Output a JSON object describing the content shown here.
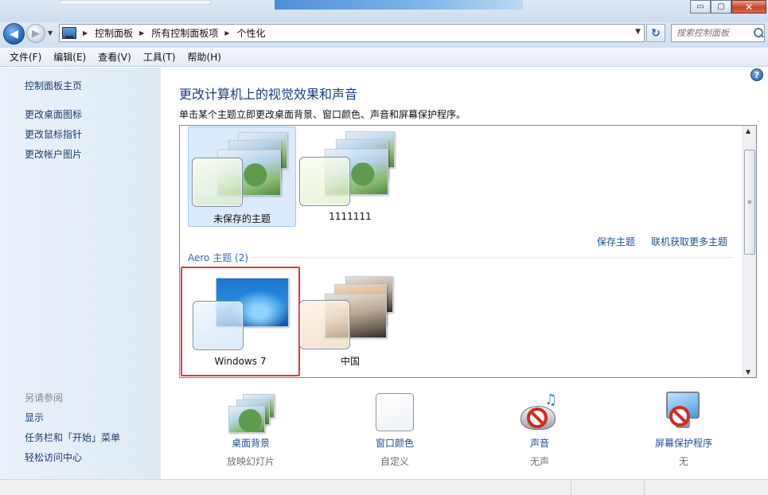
{
  "window": {
    "minimize_glyph": "▭",
    "restore_glyph": "▢",
    "close_glyph": "✕",
    "accent": "#1e4e9c"
  },
  "nav": {
    "back_glyph": "◀",
    "forward_glyph": "▶",
    "breadcrumb": [
      "控制面板",
      "所有控制面板项",
      "个性化"
    ],
    "refresh_glyph": "↻",
    "search_placeholder": "搜索控制面板"
  },
  "menu": {
    "items": [
      "文件(F)",
      "编辑(E)",
      "查看(V)",
      "工具(T)",
      "帮助(H)"
    ]
  },
  "sidebar": {
    "home": "控制面板主页",
    "links": [
      "更改桌面图标",
      "更改鼠标指针",
      "更改帐户图片"
    ],
    "see_also_label": "另请参阅",
    "see_also": [
      "显示",
      "任务栏和「开始」菜单",
      "轻松访问中心"
    ]
  },
  "main": {
    "help_glyph": "?",
    "title": "更改计算机上的视觉效果和声音",
    "description": "单击某个主题立即更改桌面背景、窗口颜色、声音和屏幕保护程序。",
    "my_themes": [
      {
        "label": "未保存的主题"
      },
      {
        "label": "1111111"
      }
    ],
    "save_theme_link": "保存主题",
    "more_themes_link": "联机获取更多主题",
    "aero_section_label": "Aero 主题 (2)",
    "aero_themes": [
      {
        "label": "Windows 7"
      },
      {
        "label": "中国"
      }
    ]
  },
  "bottom": [
    {
      "title": "桌面背景",
      "sub": "放映幻灯片",
      "icon": "desktop-background-icon"
    },
    {
      "title": "窗口颜色",
      "sub": "自定义",
      "icon": "window-color-icon"
    },
    {
      "title": "声音",
      "sub": "无声",
      "icon": "sound-icon"
    },
    {
      "title": "屏幕保护程序",
      "sub": "无",
      "icon": "screensaver-icon"
    }
  ]
}
